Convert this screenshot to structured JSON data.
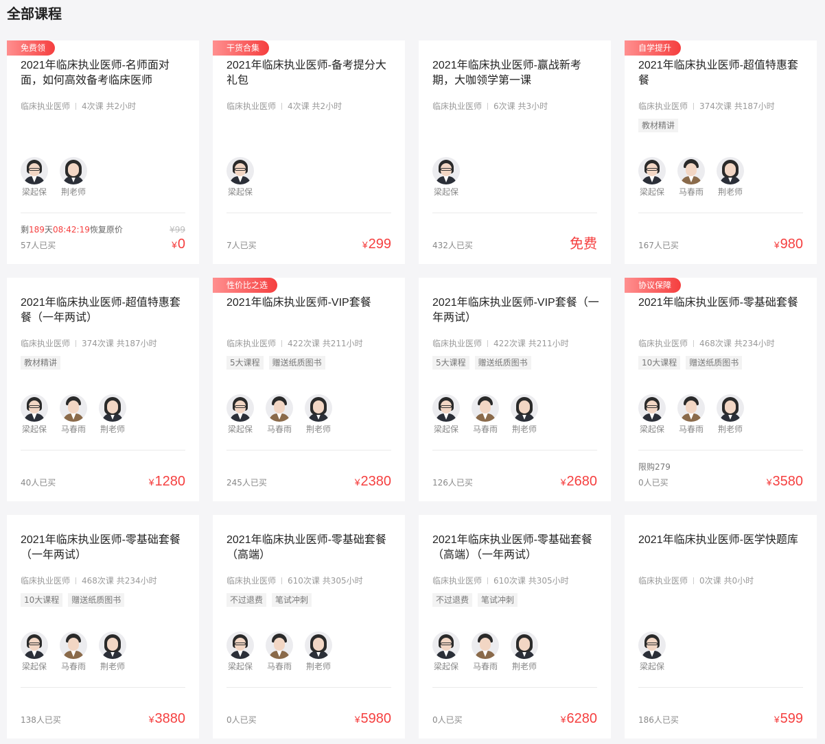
{
  "page": {
    "title": "全部课程"
  },
  "courses": [
    {
      "badge": "免费领",
      "title": "2021年临床执业医师-名师面对面，如何高效备考临床医师",
      "category": "临床执业医师",
      "lessons": "4次课 共2小时",
      "tags": [],
      "teachers": [
        "梁起保",
        "荆老师"
      ],
      "countdown": {
        "prefix": "剩",
        "days": "189",
        "day_unit": "天",
        "time": "08:42:19",
        "suffix": "恢复原价"
      },
      "original_price": "¥99",
      "buyers": "57人已买",
      "price_symbol": "¥",
      "price": "0"
    },
    {
      "badge": "干货合集",
      "title": "2021年临床执业医师-备考提分大礼包",
      "category": "临床执业医师",
      "lessons": "4次课 共2小时",
      "tags": [],
      "teachers": [
        "梁起保"
      ],
      "buyers": "7人已买",
      "price_symbol": "¥",
      "price": "299"
    },
    {
      "badge": "",
      "title": "2021年临床执业医师-赢战新考期，大咖领学第一课",
      "category": "临床执业医师",
      "lessons": "6次课 共3小时",
      "tags": [],
      "teachers": [
        "梁起保"
      ],
      "buyers": "432人已买",
      "price_symbol": "",
      "price": "免费"
    },
    {
      "badge": "自学提升",
      "title": "2021年临床执业医师-超值特惠套餐",
      "category": "临床执业医师",
      "lessons": "374次课 共187小时",
      "tags": [
        "教材精讲"
      ],
      "teachers": [
        "梁起保",
        "马春雨",
        "荆老师"
      ],
      "buyers": "167人已买",
      "price_symbol": "¥",
      "price": "980"
    },
    {
      "badge": "",
      "title": "2021年临床执业医师-超值特惠套餐（一年两试）",
      "category": "临床执业医师",
      "lessons": "374次课 共187小时",
      "tags": [
        "教材精讲"
      ],
      "teachers": [
        "梁起保",
        "马春雨",
        "荆老师"
      ],
      "buyers": "40人已买",
      "price_symbol": "¥",
      "price": "1280"
    },
    {
      "badge": "性价比之选",
      "title": "2021年临床执业医师-VIP套餐",
      "category": "临床执业医师",
      "lessons": "422次课 共211小时",
      "tags": [
        "5大课程",
        "赠送纸质图书"
      ],
      "teachers": [
        "梁起保",
        "马春雨",
        "荆老师"
      ],
      "buyers": "245人已买",
      "price_symbol": "¥",
      "price": "2380"
    },
    {
      "badge": "",
      "title": "2021年临床执业医师-VIP套餐（一年两试）",
      "category": "临床执业医师",
      "lessons": "422次课 共211小时",
      "tags": [
        "5大课程",
        "赠送纸质图书"
      ],
      "teachers": [
        "梁起保",
        "马春雨",
        "荆老师"
      ],
      "buyers": "126人已买",
      "price_symbol": "¥",
      "price": "2680"
    },
    {
      "badge": "协议保障",
      "title": "2021年临床执业医师-零基础套餐",
      "category": "临床执业医师",
      "lessons": "468次课 共234小时",
      "tags": [
        "10大课程",
        "赠送纸质图书"
      ],
      "teachers": [
        "梁起保",
        "马春雨",
        "荆老师"
      ],
      "limit": "限购279",
      "buyers": "0人已买",
      "price_symbol": "¥",
      "price": "3580"
    },
    {
      "badge": "",
      "title": "2021年临床执业医师-零基础套餐（一年两试）",
      "category": "临床执业医师",
      "lessons": "468次课 共234小时",
      "tags": [
        "10大课程",
        "赠送纸质图书"
      ],
      "teachers": [
        "梁起保",
        "马春雨",
        "荆老师"
      ],
      "buyers": "138人已买",
      "price_symbol": "¥",
      "price": "3880"
    },
    {
      "badge": "",
      "title": "2021年临床执业医师-零基础套餐（高端）",
      "category": "临床执业医师",
      "lessons": "610次课 共305小时",
      "tags": [
        "不过退费",
        "笔试冲刺"
      ],
      "teachers": [
        "梁起保",
        "马春雨",
        "荆老师"
      ],
      "buyers": "0人已买",
      "price_symbol": "¥",
      "price": "5980"
    },
    {
      "badge": "",
      "title": "2021年临床执业医师-零基础套餐（高端）（一年两试）",
      "category": "临床执业医师",
      "lessons": "610次课 共305小时",
      "tags": [
        "不过退费",
        "笔试冲刺"
      ],
      "teachers": [
        "梁起保",
        "马春雨",
        "荆老师"
      ],
      "buyers": "0人已买",
      "price_symbol": "¥",
      "price": "6280"
    },
    {
      "badge": "",
      "title": "2021年临床执业医师-医学快题库",
      "category": "临床执业医师",
      "lessons": "0次课 共0小时",
      "tags": [],
      "teachers": [
        "梁起保"
      ],
      "buyers": "186人已买",
      "price_symbol": "¥",
      "price": "599"
    }
  ],
  "colors": {
    "accent": "#f53f3f",
    "background": "#f5f5f7",
    "card": "#ffffff"
  }
}
